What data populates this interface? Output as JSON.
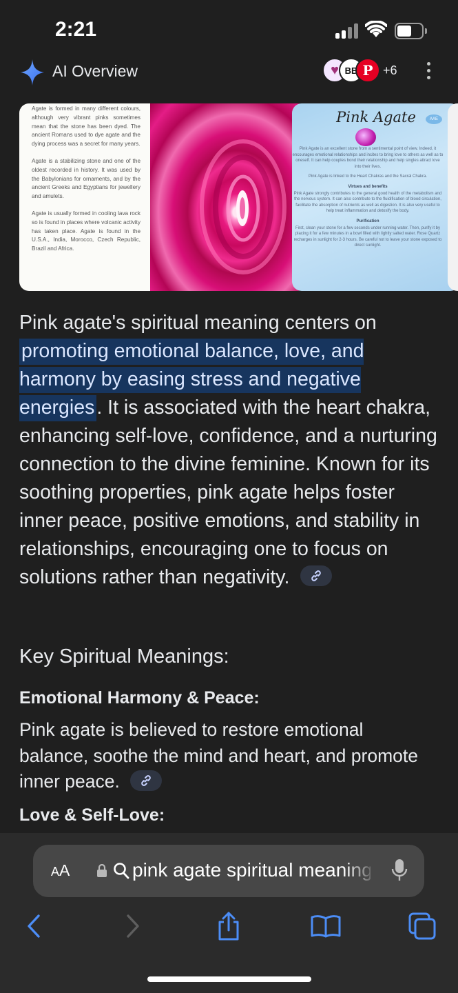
{
  "status": {
    "time": "2:21"
  },
  "overview": {
    "title": "AI Overview",
    "sources_extra": "+6",
    "source_icons": [
      "heart-logo",
      "bb-logo",
      "pinterest-logo"
    ]
  },
  "images": {
    "text_card": {
      "paragraphs": [
        "Agate is formed in many different colours, although very vibrant pinks sometimes mean that the stone has been dyed. The ancient Romans used to dye agate and the dying process was a secret for many years.",
        "Agate is a stabilizing stone and one of the oldest recorded in history. It was used by the Babylonians for ornaments, and by the ancient Greeks and Egyptians for jewellery and amulets.",
        "Agate is usually formed in cooling lava rock so is found in places where volcanic activity has taken place. Agate is found in the U.S.A., India, Morocco, Czech Republic, Brazil and Africa."
      ]
    },
    "info_card": {
      "title": "Pink Agate",
      "badge": "AAE",
      "intro": "Pink Agate is an excellent stone from a sentimental point of view. Indeed, it encourages emotional relationships and incites to bring love to others as well as to oneself. It can help couples bond their relationship and help singles attract love into their lives.",
      "chakras": "Pink Agate is linked to the Heart Chakras and the Sacral Chakra.",
      "virtues_title": "Virtues and benefits",
      "virtues": "Pink Agate strongly contributes to the general good health of the metabolism and the nervous system. It can also contribute to the fluidification of blood circulation, facilitate the absorption of nutrients as well as digestion. It is also very useful to help treat inflammation and detoxify the body.",
      "purification_title": "Purification",
      "purification": "First, clean your stone for a few seconds under running water. Then, purify it by placing it for a few minutes in a bowl filled with lightly salted water. Rose Quartz recharges in sunlight for 2-3 hours. Be careful not to leave your stone exposed to direct sunlight."
    }
  },
  "answer": {
    "lead": "Pink agate's spiritual meaning centers on ",
    "highlight": "promoting emotional balance, love, and harmony by easing stress and negative energies",
    "rest": ". It is associated with the heart chakra, enhancing self-love, confidence, and a nurturing connection to the divine feminine. Known for its soothing properties, pink agate helps foster inner peace, positive emotions, and stability in relationships, encouraging one to focus on solutions rather than negativity."
  },
  "key_section": {
    "heading": "Key Spiritual Meanings:",
    "items": [
      {
        "title": "Emotional Harmony & Peace:",
        "body": "Pink agate is believed to restore emotional balance, soothe the mind and heart, and promote inner peace."
      },
      {
        "title": "Love & Self-Love:",
        "body": ""
      }
    ]
  },
  "browser": {
    "aa_label_big": "A",
    "aa_label_small": "A",
    "url": "pink agate spiritual meaning"
  },
  "colors": {
    "background": "#1f1f1f",
    "highlight": "#17355e",
    "accent_blue": "#4c8df6",
    "address_bar": "#474747"
  }
}
